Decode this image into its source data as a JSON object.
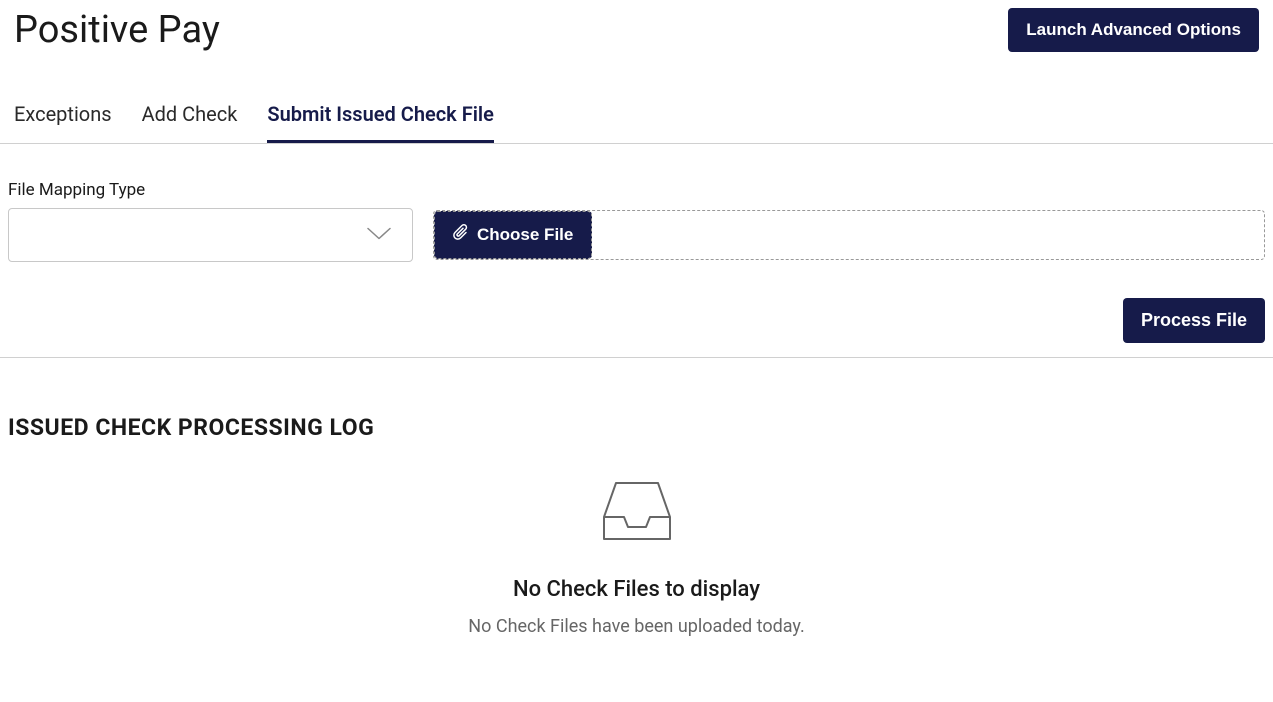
{
  "header": {
    "title": "Positive Pay",
    "advanced_button": "Launch Advanced Options"
  },
  "tabs": [
    {
      "label": "Exceptions",
      "active": false
    },
    {
      "label": "Add Check",
      "active": false
    },
    {
      "label": "Submit Issued Check File",
      "active": true
    }
  ],
  "form": {
    "mapping_label": "File Mapping Type",
    "mapping_value": "",
    "choose_file_label": "Choose File",
    "process_button": "Process File"
  },
  "log": {
    "heading": "ISSUED CHECK PROCESSING LOG",
    "empty_title": "No Check Files to display",
    "empty_subtitle": "No Check Files have been uploaded today."
  }
}
